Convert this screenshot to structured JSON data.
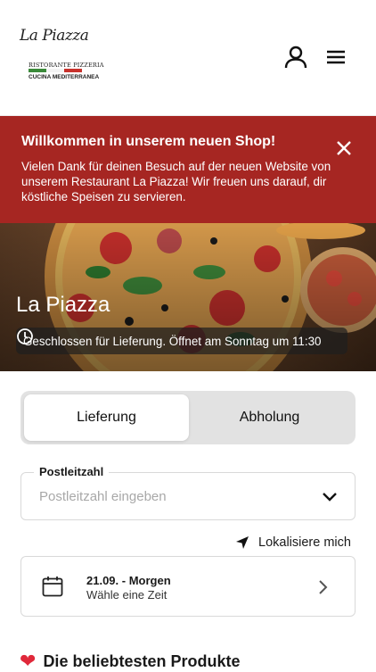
{
  "header": {
    "logo": {
      "script_text": "La Piazza",
      "line1": "RISTORANTE PIZZERIA",
      "line2": "CUCINA MEDITERRANEA"
    }
  },
  "banner": {
    "title": "Willkommen in unserem neuen Shop!",
    "text": "Vielen Dank für deinen Besuch auf der neuen Website von unserem Restaurant La Piazza! Wir freuen uns darauf, dir köstliche Speisen zu servieren.",
    "color": "#a62622"
  },
  "hero": {
    "title": "La Piazza",
    "status": "Geschlossen für Lieferung. Öffnet am Sonntag um 11:30"
  },
  "order_mode": {
    "options": [
      "Lieferung",
      "Abholung"
    ],
    "selected": "Lieferung"
  },
  "postcode": {
    "label": "Postleitzahl",
    "placeholder": "Postleitzahl eingeben",
    "value": ""
  },
  "locate": {
    "label": "Lokalisiere mich"
  },
  "time": {
    "date": "21.09. - Morgen",
    "hint": "Wähle eine Zeit"
  },
  "popular": {
    "title": "Die beliebtesten Produkte"
  },
  "icons": {
    "user": "user-icon",
    "menu": "menu-icon",
    "close": "close-icon",
    "clock": "clock-icon",
    "chevron": "chevron-down-icon",
    "locate": "location-arrow-icon",
    "calendar": "calendar-icon",
    "arrow": "chevron-right-icon",
    "heart": "heart-icon"
  }
}
